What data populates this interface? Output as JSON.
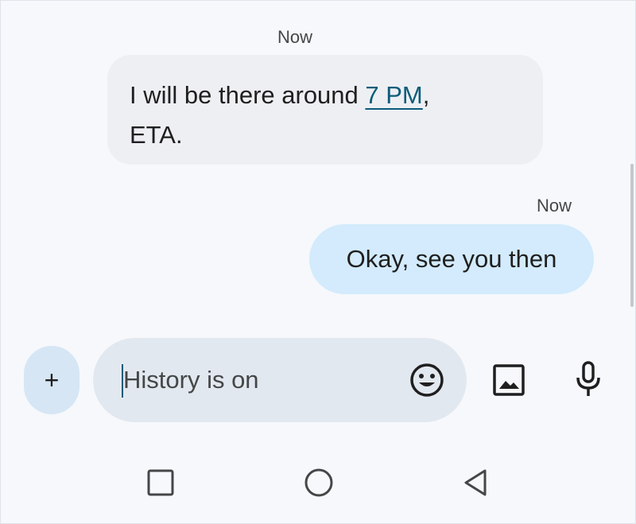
{
  "conversation": {
    "messages": [
      {
        "direction": "incoming",
        "timestamp": "Now",
        "text_before_link": "I will be there around ",
        "link_text": "7 PM",
        "text_after_link": ",",
        "text_line2": "ETA."
      },
      {
        "direction": "outgoing",
        "timestamp": "Now",
        "text": "Okay, see you then"
      }
    ]
  },
  "composer": {
    "add_label": "+",
    "placeholder": "History is on",
    "value": "",
    "emoji_icon": "emoji-icon",
    "gallery_icon": "gallery-icon",
    "mic_icon": "microphone-icon"
  },
  "navigation": {
    "recents_icon": "square-icon",
    "home_icon": "circle-icon",
    "back_icon": "triangle-back-icon"
  },
  "colors": {
    "background": "#f6f8fc",
    "incoming_bubble": "#eeeff3",
    "outgoing_bubble": "#d3ebfc",
    "compose_field": "#e2e8f0",
    "add_button": "#d6e6f4",
    "link": "#0b5c79"
  }
}
